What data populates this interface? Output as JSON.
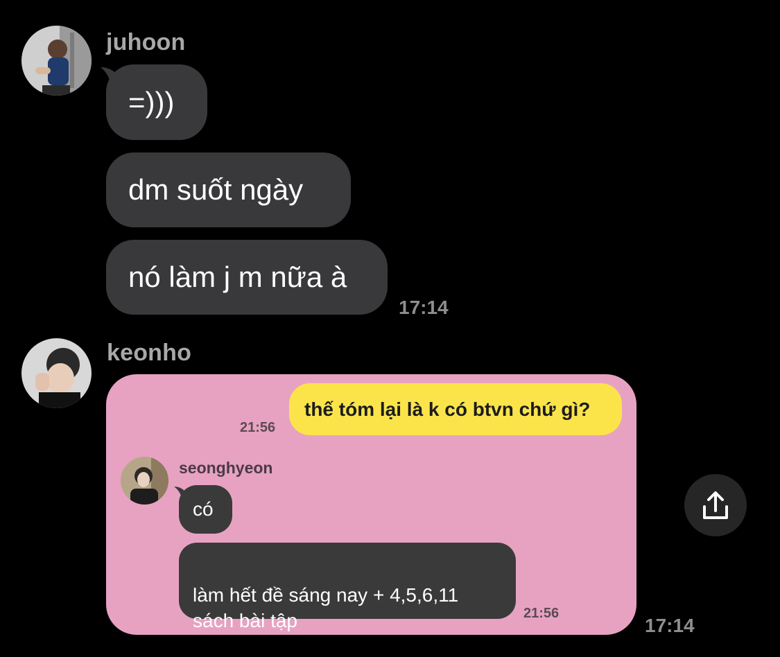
{
  "thread": [
    {
      "sender": "juhoon",
      "messages": [
        "=)))",
        "dm suốt ngày",
        "nó làm j m nữa à"
      ],
      "time": "17:14"
    },
    {
      "sender": "keonho",
      "time": "17:14",
      "shared_screenshot": {
        "outgoing": {
          "text": "thế tóm lại là k có btvn chứ gì?",
          "time": "21:56"
        },
        "incoming": {
          "sender": "seonghyeon",
          "messages": [
            "có",
            "làm hết đề sáng nay + 4,5,6,11\nsách bài tập"
          ],
          "time": "21:56"
        },
        "colors": {
          "background": "#e7a2c2",
          "outgoing_bubble": "#fbe44a",
          "incoming_bubble": "#3a3a3a"
        }
      }
    }
  ],
  "share_button": {
    "icon": "share-upload-icon"
  },
  "colors": {
    "background": "#000000",
    "bubble": "#39393b",
    "sender_name": "#a8a8a8",
    "timestamp": "#8e8e8e"
  }
}
